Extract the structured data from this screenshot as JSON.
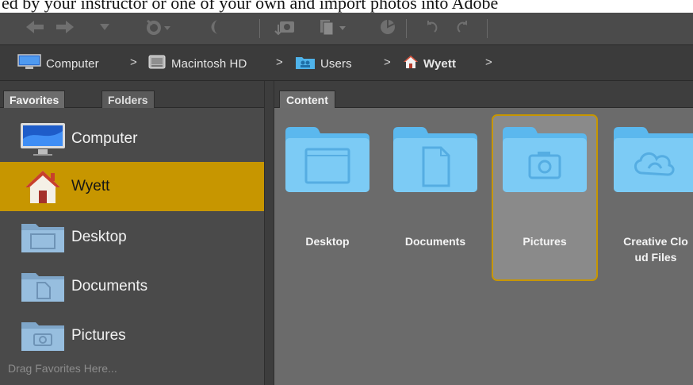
{
  "document_strip": {
    "text": "ed by your instructor or one of your own and import photos into Adobe"
  },
  "toolbar": {
    "icons": [
      "back-arrow-icon",
      "forward-arrow-icon",
      "history-dropdown-icon",
      "recent-folder-icon",
      "boomerang-icon",
      "get-photos-camera-icon",
      "refine-dropdown-icon",
      "open-in-camera-raw-icon",
      "rotate-left-icon",
      "rotate-right-icon"
    ]
  },
  "breadcrumb": {
    "items": [
      {
        "label": "Computer",
        "icon": "computer-icon"
      },
      {
        "label": "Macintosh HD",
        "icon": "hard-drive-icon"
      },
      {
        "label": "Users",
        "icon": "users-folder-icon"
      },
      {
        "label": "Wyett",
        "icon": "home-icon"
      }
    ],
    "separator": ">"
  },
  "left_panel": {
    "tabs": [
      {
        "label": "Favorites",
        "active": true
      },
      {
        "label": "Folders",
        "active": false
      }
    ],
    "favorites": [
      {
        "label": "Computer",
        "icon": "imac-icon",
        "selected": false
      },
      {
        "label": "Wyett",
        "icon": "home-icon",
        "selected": true
      },
      {
        "label": "Desktop",
        "icon": "desktop-folder-icon",
        "selected": false
      },
      {
        "label": "Documents",
        "icon": "documents-folder-icon",
        "selected": false
      },
      {
        "label": "Pictures",
        "icon": "pictures-folder-icon",
        "selected": false
      }
    ],
    "hint": "Drag Favorites Here..."
  },
  "content_panel": {
    "tab": "Content",
    "items": [
      {
        "name": "Desktop",
        "icon": "desktop-folder-icon",
        "selected": false
      },
      {
        "name": "Documents",
        "icon": "documents-folder-icon",
        "selected": false
      },
      {
        "name": "Pictures",
        "icon": "pictures-folder-icon",
        "selected": true
      },
      {
        "name": "Creative Clo\nud Files",
        "icon": "creative-cloud-folder-icon",
        "selected": false
      }
    ]
  },
  "colors": {
    "selection": "#c79600",
    "folder_blue": "#6ac3f0",
    "panel_bg": "#4a4a4a",
    "content_bg": "#6b6b6b"
  }
}
